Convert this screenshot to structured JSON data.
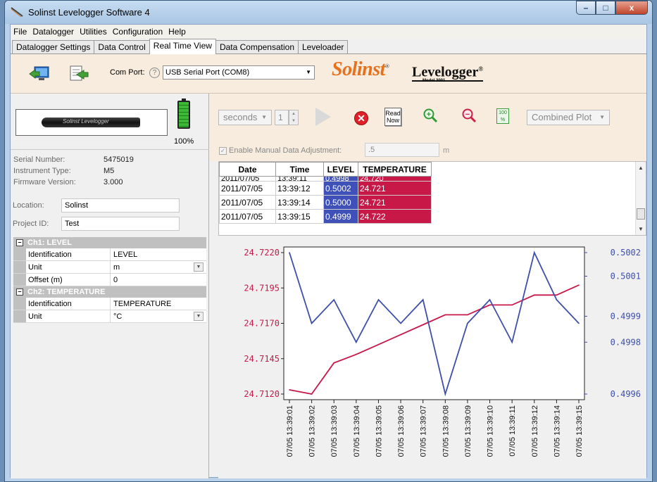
{
  "window": {
    "title": "Solinst Levelogger Software 4",
    "buttons": {
      "minimize": "–",
      "maximize": "□",
      "close": "x"
    }
  },
  "menu": [
    "File",
    "Datalogger",
    "Utilities",
    "Configuration",
    "Help"
  ],
  "tabs": [
    "Datalogger Settings",
    "Data Control",
    "Real Time View",
    "Data Compensation",
    "Leveloader"
  ],
  "active_tab": "Real Time View",
  "toolbar": {
    "com_port_label": "Com Port:",
    "help_glyph": "?",
    "com_port_value": "USB Serial Port (COM8)",
    "brand": "Solinst",
    "brand_mark": "®",
    "product": "Levelogger",
    "product_mark": "®",
    "model": "Model 3001",
    "icons": [
      "download-monitor-icon",
      "export-document-icon"
    ]
  },
  "device": {
    "image_text": "Solinst Levelogger",
    "battery_percent": "100%",
    "serial_label": "Serial Number:",
    "serial_value": "5475019",
    "type_label": "Instrument Type:",
    "type_value": "M5",
    "firmware_label": "Firmware Version:",
    "firmware_value": "3.000",
    "location_label": "Location:",
    "location_value": "Solinst",
    "project_label": "Project ID:",
    "project_value": "Test"
  },
  "channels": [
    {
      "header": "Ch1: LEVEL",
      "collapse_glyph": "–",
      "rows": [
        {
          "name": "Identification",
          "value": "LEVEL"
        },
        {
          "name": "Unit",
          "value": "m",
          "dropdown": true
        },
        {
          "name": "Offset (m)",
          "value": "0"
        }
      ]
    },
    {
      "header": "Ch2: TEMPERATURE",
      "collapse_glyph": "–",
      "rows": [
        {
          "name": "Identification",
          "value": "TEMPERATURE"
        },
        {
          "name": "Unit",
          "value": "°C",
          "dropdown": true
        }
      ]
    }
  ],
  "controls": {
    "interval_unit": "seconds",
    "interval_value": "1",
    "read_now": [
      "Read",
      "Now"
    ],
    "stop_glyph": "✕",
    "zoom_in_glyph": "+",
    "zoom_out_glyph": "−",
    "percent_icon": "100 %",
    "plot_mode": "Combined Plot",
    "enable_adjustment_label": "Enable Manual Data Adjustment:",
    "adjustment_checked": true,
    "adjustment_value": ".5",
    "adjustment_unit": "m"
  },
  "table": {
    "headers": [
      "Date",
      "Time",
      "LEVEL",
      "TEMPERATURE"
    ],
    "partial_row": [
      "2011/07/05",
      "13:39:11",
      "0.4998",
      "24.720"
    ],
    "rows": [
      [
        "2011/07/05",
        "13:39:12",
        "0.5002",
        "24.721"
      ],
      [
        "2011/07/05",
        "13:39:14",
        "0.5000",
        "24.721"
      ],
      [
        "2011/07/05",
        "13:39:15",
        "0.4999",
        "24.722"
      ]
    ]
  },
  "chart_data": {
    "type": "line",
    "x": [
      "07/05 13:39:01",
      "07/05 13:39:02",
      "07/05 13:39:03",
      "07/05 13:39:04",
      "07/05 13:39:05",
      "07/05 13:39:06",
      "07/05 13:39:07",
      "07/05 13:39:08",
      "07/05 13:39:09",
      "07/05 13:39:10",
      "07/05 13:39:11",
      "07/05 13:39:12",
      "07/05 13:39:14",
      "07/05 13:39:15"
    ],
    "series": [
      {
        "name": "TEMPERATURE",
        "axis": "left",
        "color": "#c8184a",
        "values": [
          24.7123,
          24.712,
          24.7142,
          24.7148,
          24.7155,
          24.7162,
          24.7169,
          24.7176,
          24.7176,
          24.7183,
          24.7183,
          24.719,
          24.719,
          24.7197
        ]
      },
      {
        "name": "LEVEL",
        "axis": "right",
        "color": "#3d4fa8",
        "values": [
          0.5002,
          0.4999,
          0.5,
          0.49982,
          0.5,
          0.4999,
          0.5,
          0.4996,
          0.4999,
          0.5,
          0.49982,
          0.5002,
          0.5,
          0.4999
        ]
      }
    ],
    "y_left": {
      "ticks": [
        "24.7220",
        "24.7195",
        "24.7170",
        "24.7145",
        "24.7120"
      ],
      "range": [
        24.712,
        24.722
      ],
      "color": "#c8184a"
    },
    "y_right": {
      "ticks": [
        "0.5002",
        "0.5001",
        "0.4999",
        "0.4998",
        "0.4996"
      ],
      "tick_values": [
        0.5002,
        0.5001,
        0.49993,
        0.49982,
        0.4996
      ],
      "range": [
        0.4996,
        0.5002
      ],
      "color": "#3d4fa8"
    },
    "grid": false,
    "legend": "none"
  }
}
